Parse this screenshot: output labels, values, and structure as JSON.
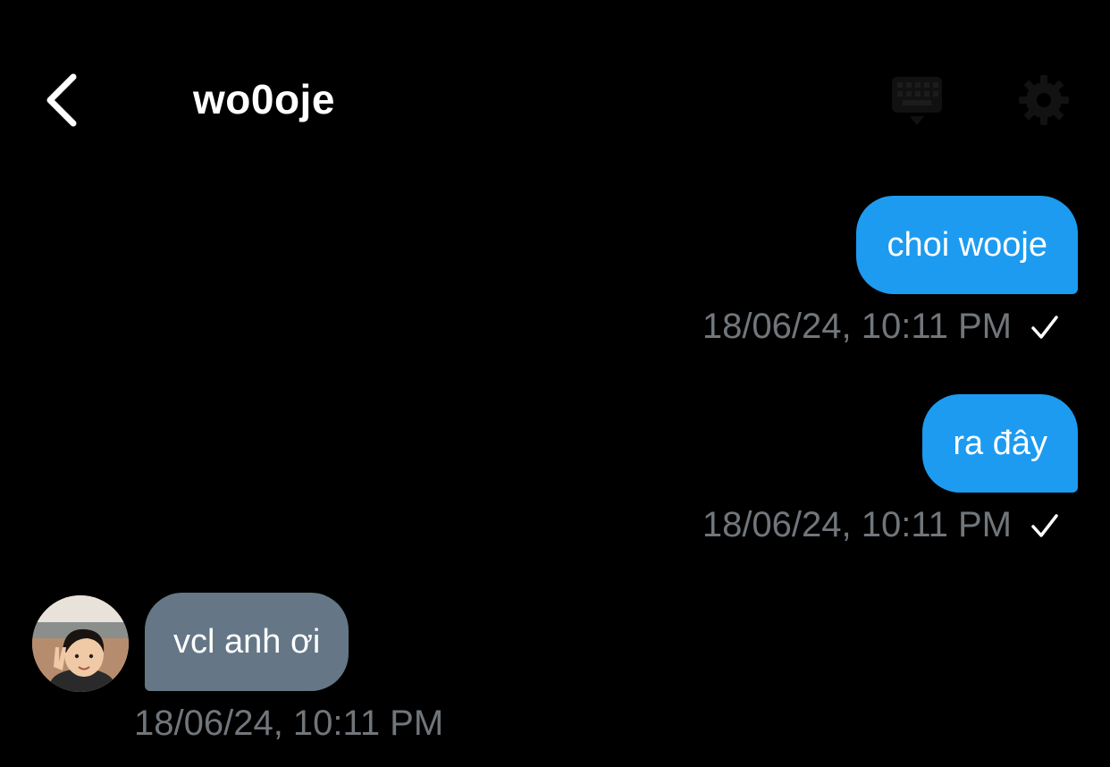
{
  "header": {
    "title": "wo0oje",
    "back_icon": "chevron-left-icon",
    "keypad_icon": "keypad-icon",
    "settings_icon": "gear-icon"
  },
  "messages": [
    {
      "direction": "outgoing",
      "text": "choi wooje",
      "timestamp": "18/06/24, 10:11 PM",
      "status_icon": "checkmark-icon"
    },
    {
      "direction": "outgoing",
      "text": "ra đây",
      "timestamp": "18/06/24, 10:11 PM",
      "status_icon": "checkmark-icon"
    },
    {
      "direction": "incoming",
      "text": "vcl anh ơi",
      "timestamp": "18/06/24, 10:11 PM",
      "avatar": "avatar"
    }
  ],
  "colors": {
    "background": "#000000",
    "outgoing_bubble": "#1d9bf0",
    "incoming_bubble": "#657786",
    "timestamp": "#71767b"
  }
}
